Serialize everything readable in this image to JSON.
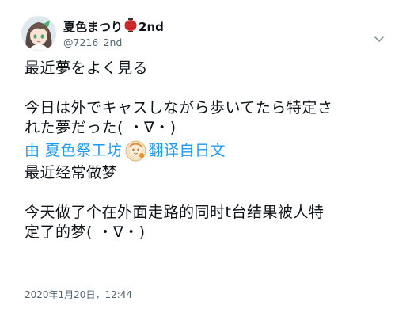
{
  "user": {
    "display_name": "夏色まつり",
    "name_suffix": "2nd",
    "handle": "@7216_2nd",
    "avatar_icon": "avatar-image",
    "badge_icon": "red-lantern-icon"
  },
  "menu": {
    "caret_icon": "chevron-down-icon"
  },
  "tweet": {
    "lines": [
      "最近夢をよく見る",
      "今日は外でキャスしながら歩いてたら特定さ",
      "れた夢だった( ・∇・)"
    ]
  },
  "translation": {
    "prefix": "由 夏色祭工坊",
    "logo_icon": "translator-logo-icon",
    "suffix": "翻译自日文",
    "lines": [
      "最近经常做梦",
      "今天做了个在外面走路的同时t台结果被人特",
      "定了的梦( ・∇・)"
    ]
  },
  "meta": {
    "timestamp": "2020年1月20日，12:44"
  },
  "colors": {
    "link": "#1d9bf0",
    "secondary": "#536471",
    "text": "#0f1419"
  }
}
